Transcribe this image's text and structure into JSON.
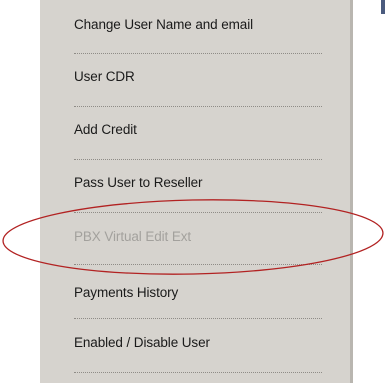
{
  "menu": {
    "items": [
      {
        "label": "Change User Name and email",
        "enabled": true
      },
      {
        "label": "User CDR",
        "enabled": true
      },
      {
        "label": "Add Credit",
        "enabled": true
      },
      {
        "label": "Pass User to Reseller",
        "enabled": true
      },
      {
        "label": "PBX Virtual Edit Ext",
        "enabled": false
      },
      {
        "label": "Payments History",
        "enabled": true
      },
      {
        "label": "Enabled / Disable User",
        "enabled": true
      }
    ]
  },
  "colors": {
    "menu_background": "#d6d3ce",
    "highlight_ellipse": "#b22222",
    "disabled_text": "#a3a19d"
  }
}
